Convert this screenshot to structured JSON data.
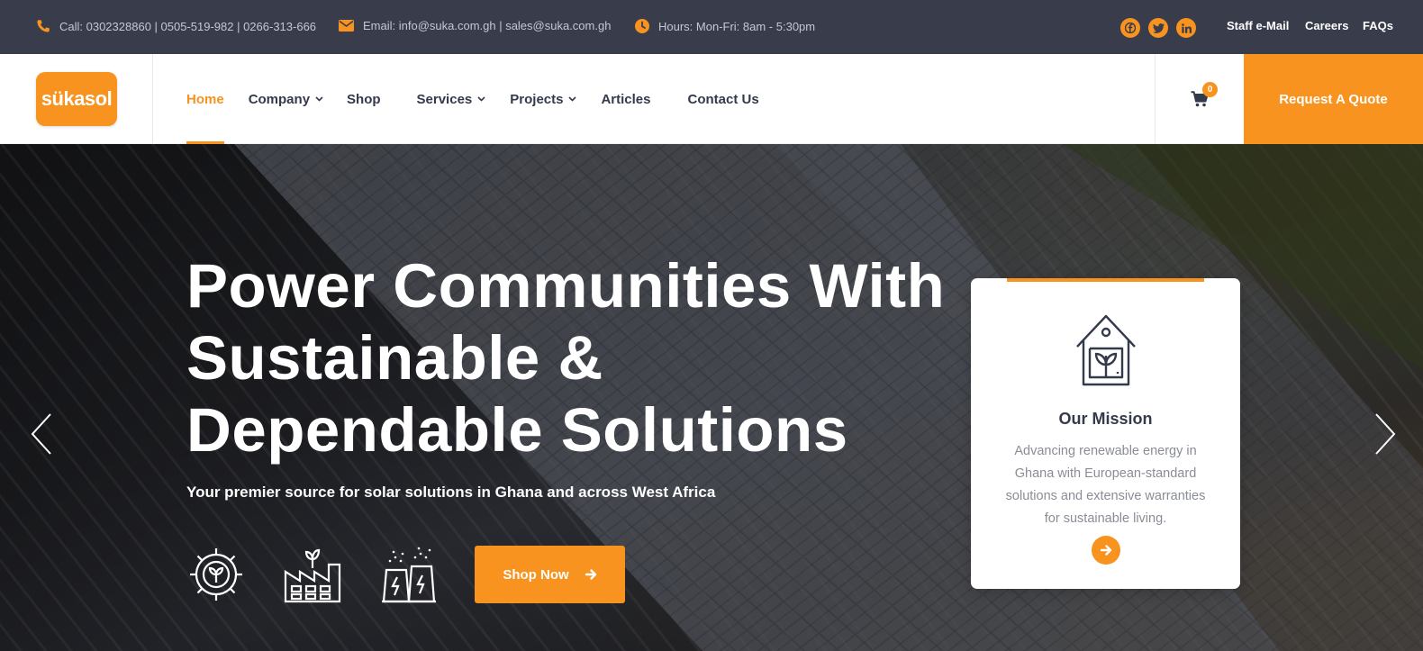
{
  "topbar": {
    "call": "Call: 0302328860 | 0505-519-982 | 0266-313-666",
    "email": "Email: info@suka.com.gh | sales@suka.com.gh",
    "hours": "Hours: Mon-Fri: 8am - 5:30pm",
    "socials": [
      "facebook-icon",
      "twitter-icon",
      "linkedin-icon"
    ],
    "links": [
      "Staff e-Mail",
      "Careers",
      "FAQs"
    ]
  },
  "header": {
    "logo_text": "sükasol",
    "nav": [
      {
        "label": "Home",
        "active": true,
        "dropdown": false
      },
      {
        "label": "Company",
        "active": false,
        "dropdown": true
      },
      {
        "label": "Shop",
        "active": false,
        "dropdown": false
      },
      {
        "label": "Services",
        "active": false,
        "dropdown": true
      },
      {
        "label": "Projects",
        "active": false,
        "dropdown": true
      },
      {
        "label": "Articles",
        "active": false,
        "dropdown": false
      },
      {
        "label": "Contact Us",
        "active": false,
        "dropdown": false
      }
    ],
    "cart_count": "0",
    "quote_label": "Request A Quote"
  },
  "hero": {
    "title": "Power Communities With Sustainable & Dependable Solutions",
    "subtitle": "Your premier source for solar solutions in Ghana and across West Africa",
    "icons": [
      "gear-leaf-icon",
      "eco-factory-icon",
      "power-plant-icon"
    ],
    "shop_label": "Shop Now"
  },
  "mission": {
    "title": "Our Mission",
    "text": "Advancing renewable energy in Ghana with European-standard solutions and extensive warranties for sustainable living."
  },
  "colors": {
    "accent": "#f7931e",
    "topbar_bg": "#393d4b",
    "nav_text": "#333a4b"
  }
}
